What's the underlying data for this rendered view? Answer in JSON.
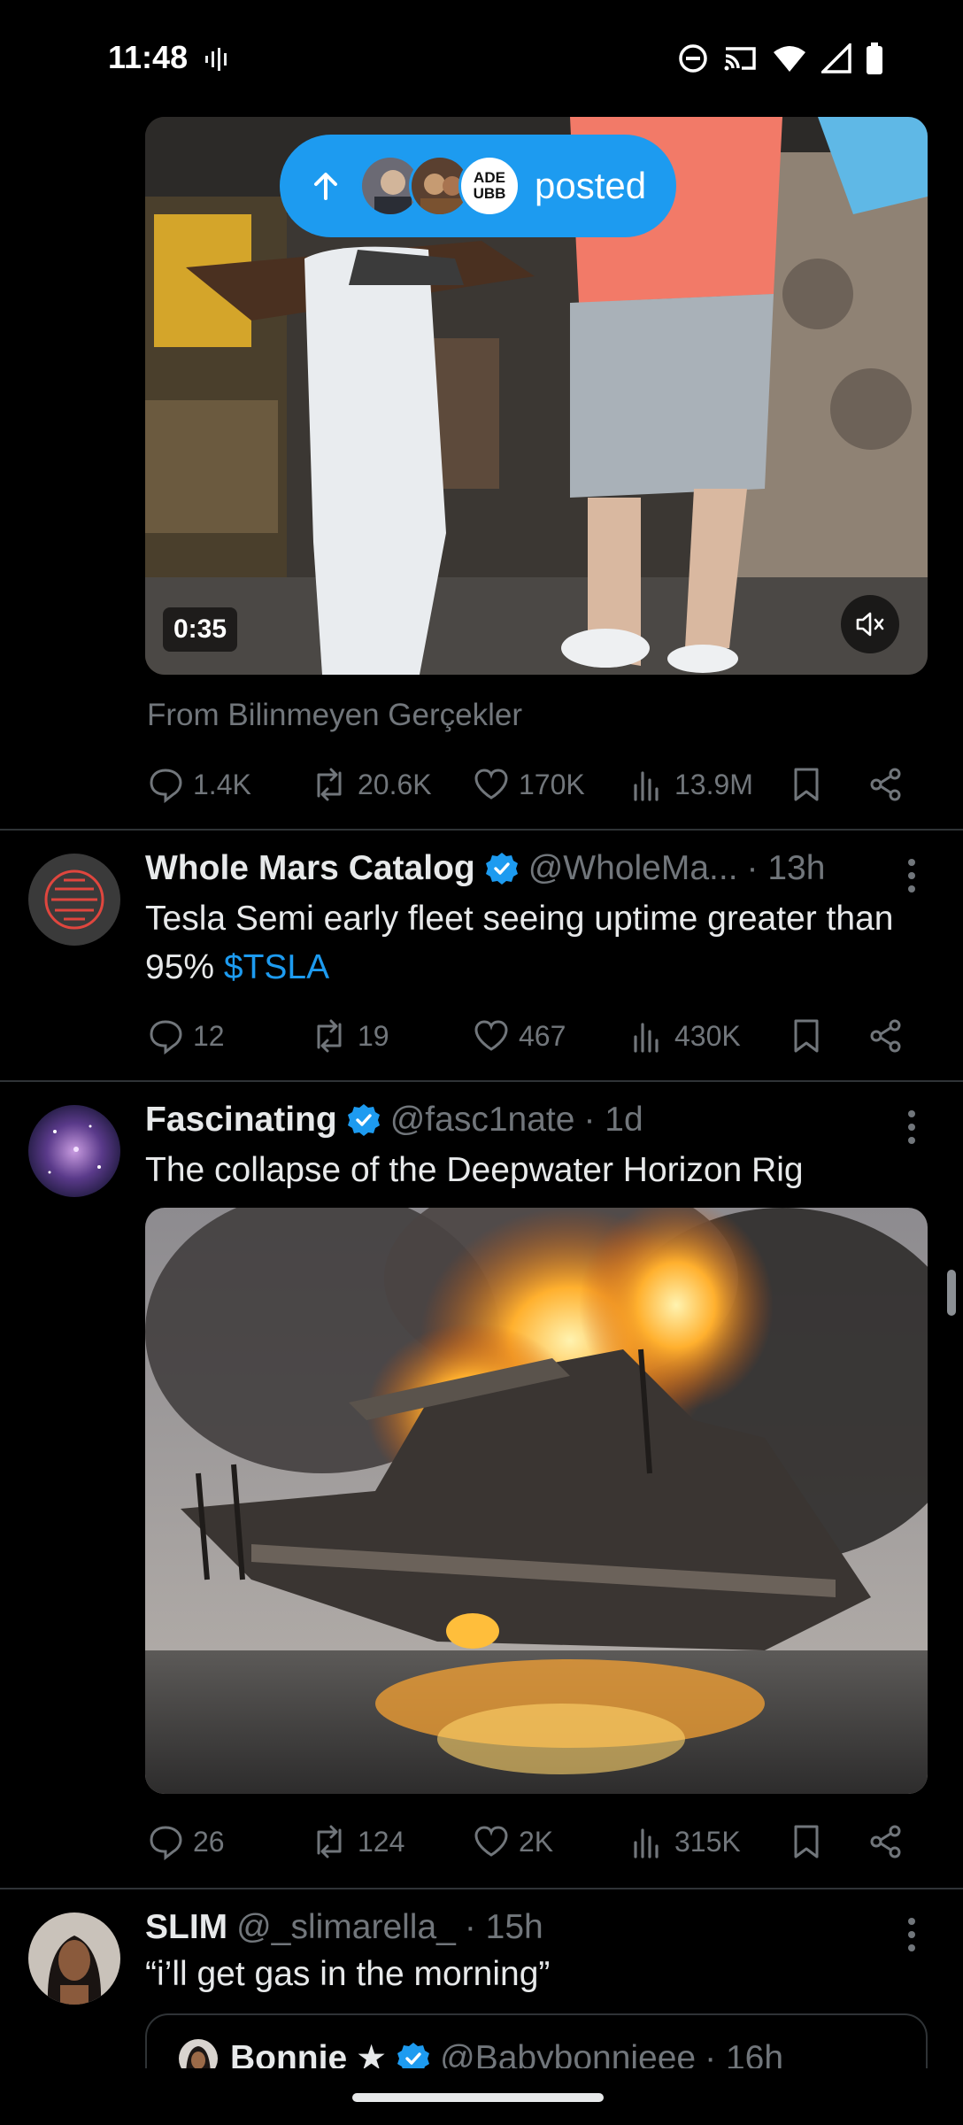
{
  "status_bar": {
    "time": "11:48"
  },
  "posted_pill": {
    "label": "posted",
    "avatar_text": "ADE UBB"
  },
  "video": {
    "duration": "0:35",
    "source": "From Bilinmeyen Gerçekler"
  },
  "tweet0": {
    "replies": "1.4K",
    "reposts": "20.6K",
    "likes": "170K",
    "views": "13.9M"
  },
  "tweets": [
    {
      "name": "Whole Mars Catalog",
      "handle": "@WholeMa...",
      "time": "· 13h",
      "text": "Tesla Semi early fleet seeing uptime greater than 95%",
      "cashtag": "$TSLA",
      "replies": "12",
      "reposts": "19",
      "likes": "467",
      "views": "430K"
    },
    {
      "name": "Fascinating",
      "handle": "@fasc1nate",
      "time": "· 1d",
      "text": "The collapse of the Deepwater Horizon Rig",
      "replies": "26",
      "reposts": "124",
      "likes": "2K",
      "views": "315K"
    },
    {
      "name": "SLIM",
      "handle": "@_slimarella_",
      "time": "· 15h",
      "text": "“i’ll get gas in the morning”",
      "quote": {
        "name": "Bonnie",
        "star": "★",
        "handle": "@Babybonnieee",
        "time": "· 16h"
      }
    }
  ],
  "colors": {
    "accent": "#1d9bf0",
    "muted": "#71767b",
    "divider": "#2f3336"
  }
}
